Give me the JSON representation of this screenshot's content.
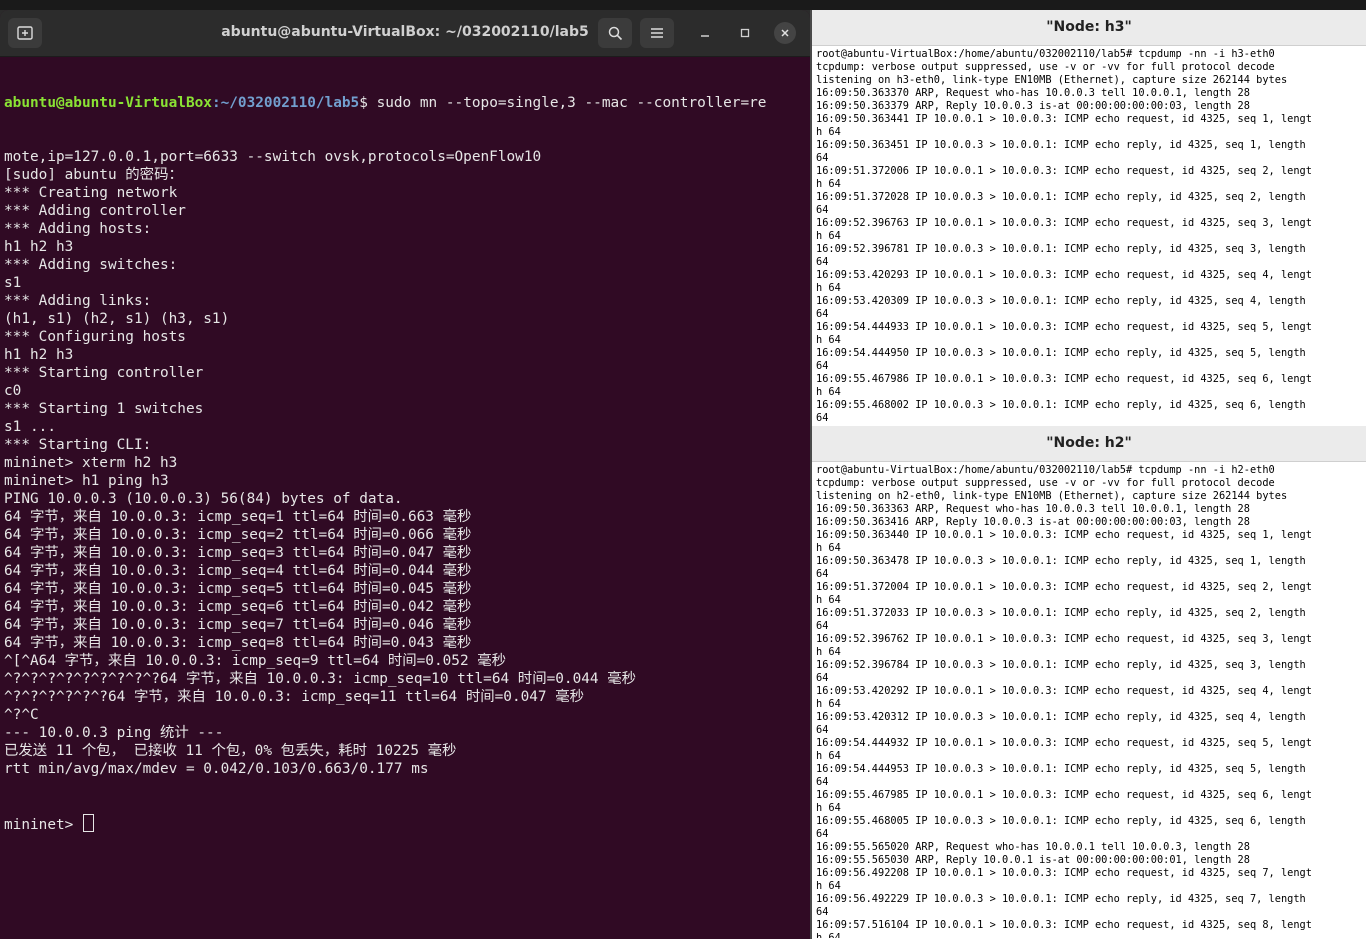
{
  "terminal": {
    "title": "abuntu@abuntu-VirtualBox: ~/032002110/lab5",
    "prompt_user": "abuntu@abuntu-VirtualBox",
    "prompt_path": ":~/032002110/lab5",
    "prompt_end": "$ ",
    "first_command": "sudo mn --topo=single,3 --mac --controller=re",
    "lines": [
      "mote,ip=127.0.0.1,port=6633 --switch ovsk,protocols=OpenFlow10",
      "[sudo] abuntu 的密码：",
      "*** Creating network",
      "*** Adding controller",
      "*** Adding hosts:",
      "h1 h2 h3",
      "*** Adding switches:",
      "s1",
      "*** Adding links:",
      "(h1, s1) (h2, s1) (h3, s1)",
      "*** Configuring hosts",
      "h1 h2 h3",
      "*** Starting controller",
      "c0",
      "*** Starting 1 switches",
      "s1 ...",
      "*** Starting CLI:",
      "mininet> xterm h2 h3",
      "mininet> h1 ping h3",
      "PING 10.0.0.3 (10.0.0.3) 56(84) bytes of data.",
      "64 字节，来自 10.0.0.3: icmp_seq=1 ttl=64 时间=0.663 毫秒",
      "64 字节，来自 10.0.0.3: icmp_seq=2 ttl=64 时间=0.066 毫秒",
      "64 字节，来自 10.0.0.3: icmp_seq=3 ttl=64 时间=0.047 毫秒",
      "64 字节，来自 10.0.0.3: icmp_seq=4 ttl=64 时间=0.044 毫秒",
      "64 字节，来自 10.0.0.3: icmp_seq=5 ttl=64 时间=0.045 毫秒",
      "64 字节，来自 10.0.0.3: icmp_seq=6 ttl=64 时间=0.042 毫秒",
      "64 字节，来自 10.0.0.3: icmp_seq=7 ttl=64 时间=0.046 毫秒",
      "64 字节，来自 10.0.0.3: icmp_seq=8 ttl=64 时间=0.043 毫秒",
      "^[^A64 字节，来自 10.0.0.3: icmp_seq=9 ttl=64 时间=0.052 毫秒",
      "^?^?^?^?^?^?^?^?^?64 字节，来自 10.0.0.3: icmp_seq=10 ttl=64 时间=0.044 毫秒",
      "^?^?^?^?^?^?64 字节，来自 10.0.0.3: icmp_seq=11 ttl=64 时间=0.047 毫秒",
      "^?^C",
      "--- 10.0.0.3 ping 统计 ---",
      "已发送 11 个包， 已接收 11 个包，0% 包丢失，耗时 10225 毫秒",
      "rtt min/avg/max/mdev = 0.042/0.103/0.663/0.177 ms"
    ],
    "last_prompt": "mininet> "
  },
  "xterm_h3": {
    "title": "\"Node: h3\"",
    "lines": [
      "root@abuntu-VirtualBox:/home/abuntu/032002110/lab5# tcpdump -nn -i h3-eth0",
      "tcpdump: verbose output suppressed, use -v or -vv for full protocol decode",
      "listening on h3-eth0, link-type EN10MB (Ethernet), capture size 262144 bytes",
      "16:09:50.363370 ARP, Request who-has 10.0.0.3 tell 10.0.0.1, length 28",
      "16:09:50.363379 ARP, Reply 10.0.0.3 is-at 00:00:00:00:00:03, length 28",
      "16:09:50.363441 IP 10.0.0.1 > 10.0.0.3: ICMP echo request, id 4325, seq 1, lengt",
      "h 64",
      "16:09:50.363451 IP 10.0.0.3 > 10.0.0.1: ICMP echo reply, id 4325, seq 1, length",
      "64",
      "16:09:51.372006 IP 10.0.0.1 > 10.0.0.3: ICMP echo request, id 4325, seq 2, lengt",
      "h 64",
      "16:09:51.372028 IP 10.0.0.3 > 10.0.0.1: ICMP echo reply, id 4325, seq 2, length",
      "64",
      "16:09:52.396763 IP 10.0.0.1 > 10.0.0.3: ICMP echo request, id 4325, seq 3, lengt",
      "h 64",
      "16:09:52.396781 IP 10.0.0.3 > 10.0.0.1: ICMP echo reply, id 4325, seq 3, length",
      "64",
      "16:09:53.420293 IP 10.0.0.1 > 10.0.0.3: ICMP echo request, id 4325, seq 4, lengt",
      "h 64",
      "16:09:53.420309 IP 10.0.0.3 > 10.0.0.1: ICMP echo reply, id 4325, seq 4, length",
      "64",
      "16:09:54.444933 IP 10.0.0.1 > 10.0.0.3: ICMP echo request, id 4325, seq 5, lengt",
      "h 64",
      "16:09:54.444950 IP 10.0.0.3 > 10.0.0.1: ICMP echo reply, id 4325, seq 5, length",
      "64",
      "16:09:55.467986 IP 10.0.0.1 > 10.0.0.3: ICMP echo request, id 4325, seq 6, lengt",
      "h 64",
      "16:09:55.468002 IP 10.0.0.3 > 10.0.0.1: ICMP echo reply, id 4325, seq 6, length",
      "64"
    ]
  },
  "xterm_h2": {
    "title": "\"Node: h2\"",
    "lines": [
      "root@abuntu-VirtualBox:/home/abuntu/032002110/lab5# tcpdump -nn -i h2-eth0",
      "tcpdump: verbose output suppressed, use -v or -vv for full protocol decode",
      "listening on h2-eth0, link-type EN10MB (Ethernet), capture size 262144 bytes",
      "16:09:50.363363 ARP, Request who-has 10.0.0.3 tell 10.0.0.1, length 28",
      "16:09:50.363416 ARP, Reply 10.0.0.3 is-at 00:00:00:00:00:03, length 28",
      "16:09:50.363440 IP 10.0.0.1 > 10.0.0.3: ICMP echo request, id 4325, seq 1, lengt",
      "h 64",
      "16:09:50.363478 IP 10.0.0.3 > 10.0.0.1: ICMP echo reply, id 4325, seq 1, length",
      "64",
      "16:09:51.372004 IP 10.0.0.1 > 10.0.0.3: ICMP echo request, id 4325, seq 2, lengt",
      "h 64",
      "16:09:51.372033 IP 10.0.0.3 > 10.0.0.1: ICMP echo reply, id 4325, seq 2, length",
      "64",
      "16:09:52.396762 IP 10.0.0.1 > 10.0.0.3: ICMP echo request, id 4325, seq 3, lengt",
      "h 64",
      "16:09:52.396784 IP 10.0.0.3 > 10.0.0.1: ICMP echo reply, id 4325, seq 3, length",
      "64",
      "16:09:53.420292 IP 10.0.0.1 > 10.0.0.3: ICMP echo request, id 4325, seq 4, lengt",
      "h 64",
      "16:09:53.420312 IP 10.0.0.3 > 10.0.0.1: ICMP echo reply, id 4325, seq 4, length",
      "64",
      "16:09:54.444932 IP 10.0.0.1 > 10.0.0.3: ICMP echo request, id 4325, seq 5, lengt",
      "h 64",
      "16:09:54.444953 IP 10.0.0.3 > 10.0.0.1: ICMP echo reply, id 4325, seq 5, length",
      "64",
      "16:09:55.467985 IP 10.0.0.1 > 10.0.0.3: ICMP echo request, id 4325, seq 6, lengt",
      "h 64",
      "16:09:55.468005 IP 10.0.0.3 > 10.0.0.1: ICMP echo reply, id 4325, seq 6, length",
      "64",
      "16:09:55.565020 ARP, Request who-has 10.0.0.1 tell 10.0.0.3, length 28",
      "16:09:55.565030 ARP, Reply 10.0.0.1 is-at 00:00:00:00:00:01, length 28",
      "16:09:56.492208 IP 10.0.0.1 > 10.0.0.3: ICMP echo request, id 4325, seq 7, lengt",
      "h 64",
      "16:09:56.492229 IP 10.0.0.3 > 10.0.0.1: ICMP echo reply, id 4325, seq 7, length",
      "64",
      "16:09:57.516104 IP 10.0.0.1 > 10.0.0.3: ICMP echo request, id 4325, seq 8, lengt",
      "h 64"
    ]
  },
  "icons": {
    "new_tab": "new-tab-icon",
    "search": "search-icon",
    "menu": "hamburger-menu-icon",
    "minimize": "minimize-icon",
    "maximize": "maximize-icon",
    "close": "close-icon"
  }
}
